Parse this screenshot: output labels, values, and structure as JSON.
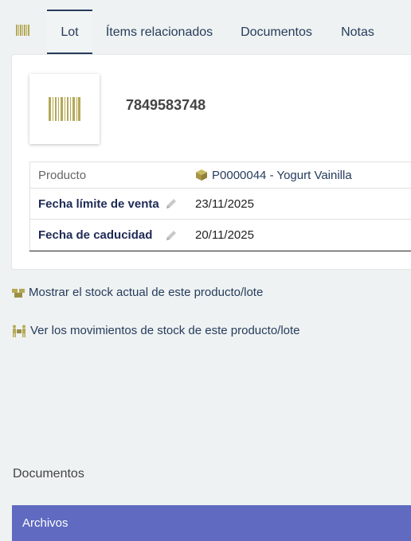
{
  "tabs": [
    {
      "label": "Lot",
      "active": true
    },
    {
      "label": "Ítems relacionados",
      "active": false
    },
    {
      "label": "Documentos",
      "active": false
    },
    {
      "label": "Notas",
      "active": false
    }
  ],
  "lot": {
    "ref": "7849583748"
  },
  "fields": {
    "product_label": "Producto",
    "product_value": "P0000044 - Yogurt Vainilla",
    "sellby_label": "Fecha límite de venta",
    "sellby_value": "23/11/2025",
    "eatby_label": "Fecha de caducidad",
    "eatby_value": "20/11/2025"
  },
  "links": {
    "stock": "Mostrar el stock actual de este producto/lote",
    "movements": "Ver los movimientos de stock de este producto/lote"
  },
  "documents": {
    "section_title": "Documentos",
    "files_header": "Archivos"
  },
  "colors": {
    "accent": "#263c5c",
    "files_bar": "#5f6ac0",
    "barcode": "#b5a855"
  },
  "icons": {
    "tab": "barcode-icon",
    "product": "box-icon",
    "stock": "boxes-icon",
    "movements": "people-carry-icon",
    "edit": "pencil-icon"
  }
}
